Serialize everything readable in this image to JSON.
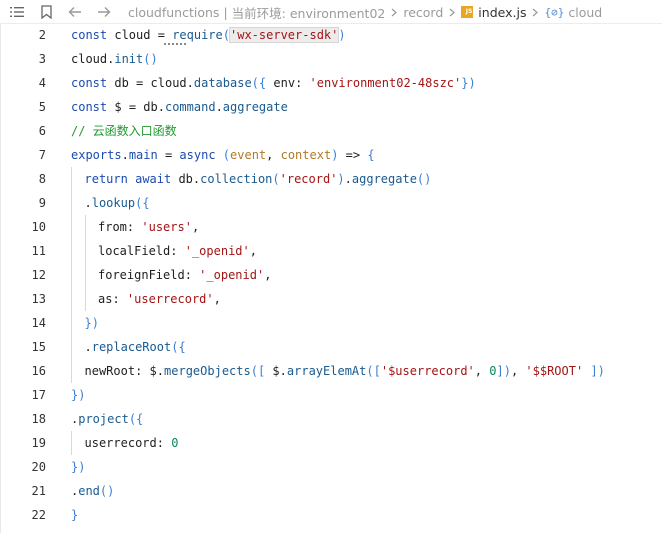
{
  "toolbar": {
    "breadcrumb": {
      "root": "cloudfunctions",
      "env_label": "当前环境: environment02",
      "folder": "record",
      "file": "index.js",
      "symbol": "cloud"
    }
  },
  "icons": {
    "list": "list-icon",
    "bookmark": "bookmark-icon",
    "back": "arrow-left-icon",
    "forward": "arrow-right-icon",
    "js": "js-file-icon",
    "symbol": "symbol-icon"
  },
  "editor": {
    "lines": [
      {
        "n": "2",
        "code": "const cloud = require('wx-server-sdk')"
      },
      {
        "n": "3",
        "code": "cloud.init()"
      },
      {
        "n": "4",
        "code": "const db = cloud.database({ env: 'environment02-48szc'})"
      },
      {
        "n": "5",
        "code": "const $ = db.command.aggregate"
      },
      {
        "n": "6",
        "code": "// 云函数入口函数"
      },
      {
        "n": "7",
        "code": "exports.main = async (event, context) => {"
      },
      {
        "n": "8",
        "code": "return await db.collection('record').aggregate()"
      },
      {
        "n": "9",
        "code": ".lookup({"
      },
      {
        "n": "10",
        "code": "from: 'users',"
      },
      {
        "n": "11",
        "code": "localField: '_openid',"
      },
      {
        "n": "12",
        "code": "foreignField: '_openid',"
      },
      {
        "n": "13",
        "code": "as: 'userrecord',"
      },
      {
        "n": "14",
        "code": "})"
      },
      {
        "n": "15",
        "code": ".replaceRoot({"
      },
      {
        "n": "16",
        "code": "newRoot: $.mergeObjects([ $.arrayElemAt(['$userrecord', 0]), '$$ROOT' ])"
      },
      {
        "n": "17",
        "code": "})"
      },
      {
        "n": "18",
        "code": ".project({"
      },
      {
        "n": "19",
        "code": "userrecord: 0"
      },
      {
        "n": "20",
        "code": "})"
      },
      {
        "n": "21",
        "code": ".end()"
      },
      {
        "n": "22",
        "code": "}"
      }
    ]
  }
}
